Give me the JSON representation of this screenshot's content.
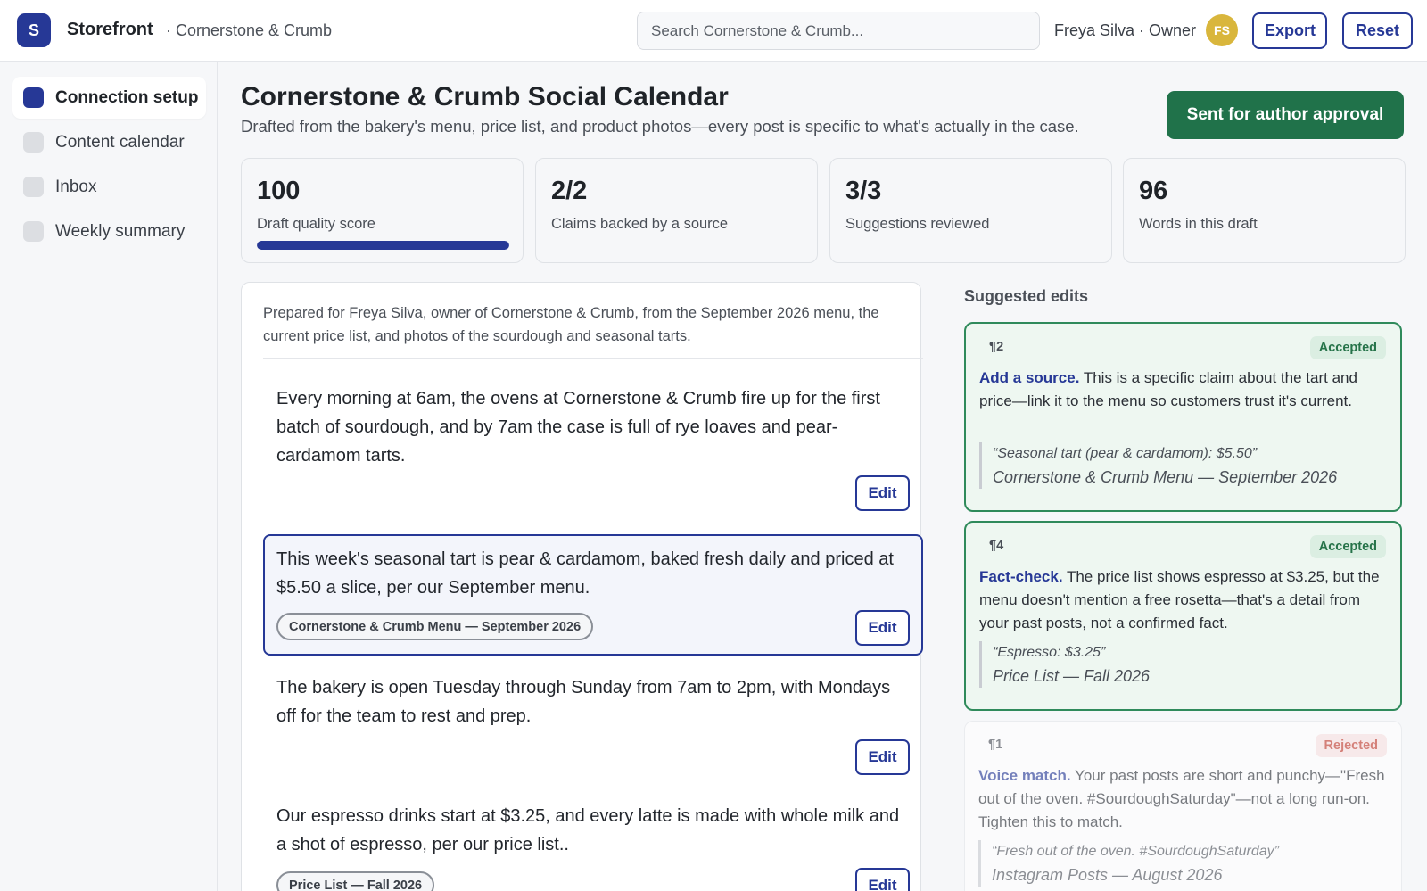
{
  "header": {
    "logo_letter": "S",
    "brand": "Storefront",
    "breadcrumb": "· Cornerstone & Crumb",
    "search_placeholder": "Search Cornerstone & Crumb...",
    "user": "Freya Silva · Owner",
    "avatar_initials": "FS",
    "export_label": "Export",
    "reset_label": "Reset"
  },
  "sidebar": {
    "items": [
      {
        "label": "Connection setup",
        "active": true
      },
      {
        "label": "Content calendar",
        "active": false
      },
      {
        "label": "Inbox",
        "active": false
      },
      {
        "label": "Weekly summary",
        "active": false
      }
    ]
  },
  "page": {
    "title": "Cornerstone & Crumb Social Calendar",
    "subtitle": "Drafted from the bakery's menu, price list, and product photos—every post is specific to what's actually in the case.",
    "approval_label": "Sent for author approval"
  },
  "stats": [
    {
      "value": "100",
      "label": "Draft quality score",
      "progress": 1.0
    },
    {
      "value": "2/2",
      "label": "Claims backed by a source"
    },
    {
      "value": "3/3",
      "label": "Suggestions reviewed"
    },
    {
      "value": "96",
      "label": "Words in this draft"
    }
  ],
  "draft": {
    "intro": "Prepared for Freya Silva, owner of Cornerstone & Crumb, from the September 2026 menu, the current price list, and photos of the sourdough and seasonal tarts.",
    "edit_label": "Edit",
    "paragraphs": [
      {
        "text": "Every morning at 6am, the ovens at Cornerstone & Crumb fire up for the first batch of sourdough, and by 7am the case is full of rye loaves and pear-cardamom tarts.",
        "source": ""
      },
      {
        "text": "This week's seasonal tart is pear & cardamom, baked fresh daily and priced at $5.50 a slice, per our September menu.",
        "source": "Cornerstone & Crumb Menu — September 2026"
      },
      {
        "text": "The bakery is open Tuesday through Sunday from 7am to 2pm, with Mondays off for the team to rest and prep.",
        "source": ""
      },
      {
        "text": "Our espresso drinks start at $3.25, and every latte is made with whole milk and a shot of espresso, per our price list..",
        "source": "Price List — Fall 2026"
      }
    ]
  },
  "suggestions": {
    "heading": "Suggested edits",
    "items": [
      {
        "para": "¶2",
        "status": "Accepted",
        "kind": "Add a source.",
        "body": "This is a specific claim about the tart and price—link it to the menu so customers trust it's current.",
        "quote": "“Seasonal tart (pear & cardamom): $5.50”",
        "source": "Cornerstone & Crumb Menu — September 2026"
      },
      {
        "para": "¶4",
        "status": "Accepted",
        "kind": "Fact-check.",
        "body": "The price list shows espresso at $3.25, but the menu doesn't mention a free rosetta—that's a detail from your past posts, not a confirmed fact.",
        "quote": "“Espresso: $3.25”",
        "source": "Price List — Fall 2026"
      },
      {
        "para": "¶1",
        "status": "Rejected",
        "kind": "Voice match.",
        "body": "Your past posts are short and punchy—\"Fresh out of the oven. #SourdoughSaturday\"—not a long run-on. Tighten this to match.",
        "quote": "“Fresh out of the oven. #SourdoughSaturday”",
        "source": "Instagram Posts — August 2026"
      }
    ]
  },
  "colors": {
    "accent": "#263896",
    "approve": "#20724a",
    "accepted_border": "#2f8a5b",
    "avatar": "#d9b63c"
  }
}
